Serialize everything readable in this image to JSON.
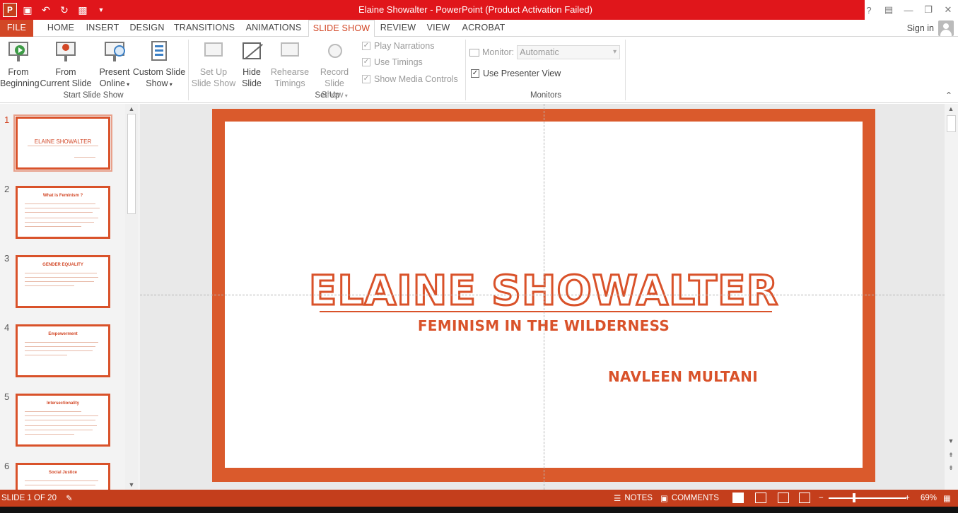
{
  "window": {
    "title": "Elaine Showalter -  PowerPoint (Product Activation Failed)",
    "app_logo": "P",
    "help": "?"
  },
  "tabs": {
    "file": "FILE",
    "home": "HOME",
    "insert": "INSERT",
    "design": "DESIGN",
    "transitions": "TRANSITIONS",
    "animations": "ANIMATIONS",
    "slide_show": "SLIDE SHOW",
    "review": "REVIEW",
    "view": "VIEW",
    "acrobat": "ACROBAT",
    "active": "SLIDE SHOW"
  },
  "account": {
    "sign_in": "Sign in"
  },
  "ribbon": {
    "start_group": {
      "label": "Start Slide Show",
      "from_beginning": [
        "From",
        "Beginning"
      ],
      "from_current": [
        "From",
        "Current Slide"
      ],
      "present_online": [
        "Present",
        "Online"
      ],
      "custom_show": [
        "Custom Slide",
        "Show"
      ]
    },
    "setup_group": {
      "label": "Set Up",
      "set_up": [
        "Set Up",
        "Slide Show"
      ],
      "hide_slide": [
        "Hide",
        "Slide"
      ],
      "rehearse": [
        "Rehearse",
        "Timings"
      ],
      "record": [
        "Record Slide",
        "Show"
      ],
      "play_narrations": "Play Narrations",
      "use_timings": "Use Timings",
      "show_media_controls": "Show Media Controls"
    },
    "monitors_group": {
      "label": "Monitors",
      "monitor_label": "Monitor:",
      "monitor_value": "Automatic",
      "use_presenter_view": "Use Presenter View"
    }
  },
  "thumbnails": [
    {
      "num": "1",
      "title": "ELAINE SHOWALTER"
    },
    {
      "num": "2",
      "title": "What is Feminism ?"
    },
    {
      "num": "3",
      "title": "GENDER EQUALITY"
    },
    {
      "num": "4",
      "title": "Empowerment"
    },
    {
      "num": "5",
      "title": "Intersectionality"
    },
    {
      "num": "6",
      "title": "Social Justice"
    }
  ],
  "slide": {
    "title": "ELAINE SHOWALTER",
    "subtitle": "FEMINISM IN THE WILDERNESS",
    "author": "NAVLEEN MULTANI"
  },
  "status": {
    "slide_counter": "SLIDE 1 OF 20",
    "notes": "NOTES",
    "comments": "COMMENTS",
    "zoom": "69%"
  },
  "colors": {
    "title_bar": "#e0161b",
    "accent": "#d24726",
    "slide_orange": "#da5a2c",
    "status_bar": "#c43e1c"
  }
}
